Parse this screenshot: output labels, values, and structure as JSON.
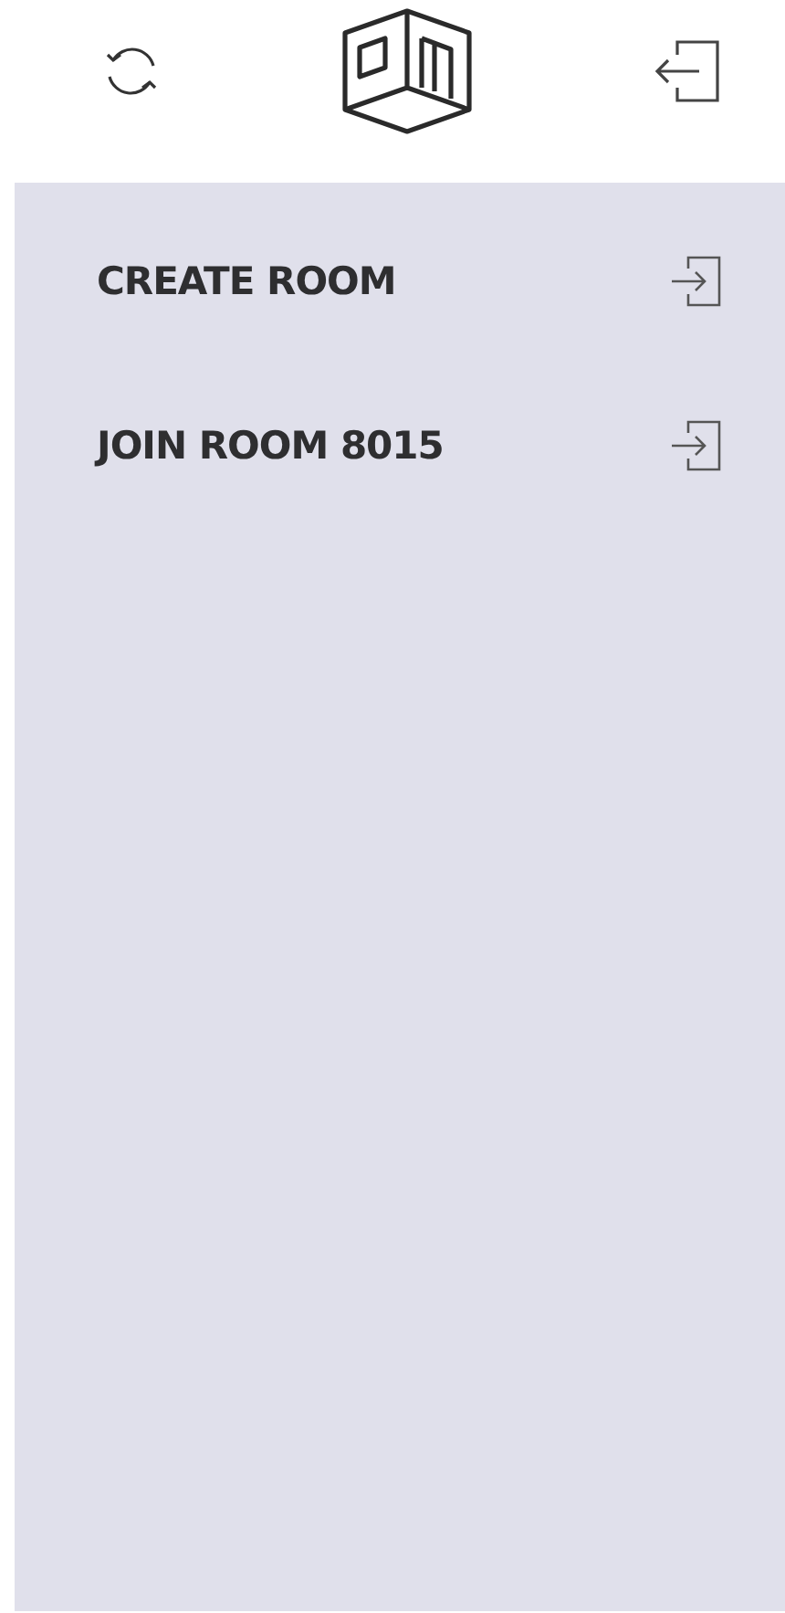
{
  "menu": [
    {
      "label": "CREATE ROOM"
    },
    {
      "label": "JOIN ROOM 8015"
    }
  ]
}
